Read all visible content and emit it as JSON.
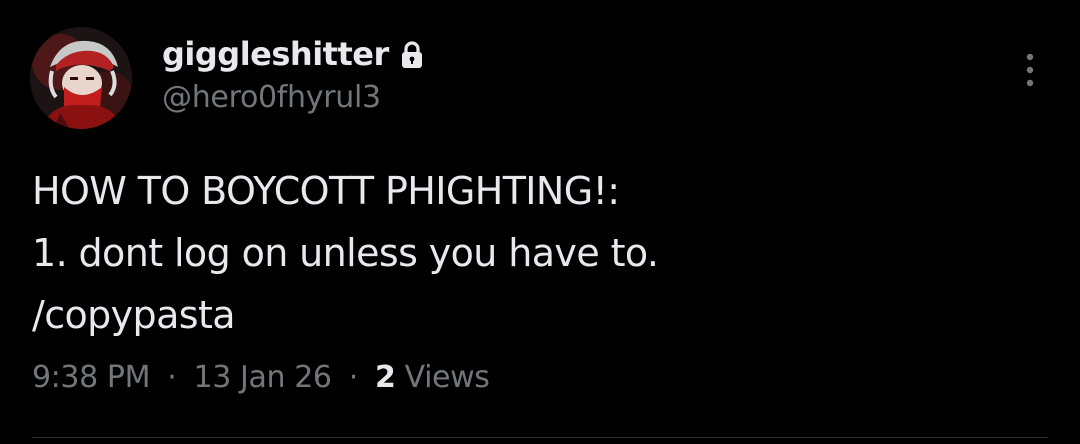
{
  "author": {
    "display_name": "giggleshitter",
    "handle": "@hero0fhyrul3",
    "protected_icon": "lock-icon",
    "avatar": "avatar-image"
  },
  "tweet": {
    "lines": [
      "HOW TO BOYCOTT PHIGHTING!:",
      "1. dont log on unless you have to.",
      "/copypasta"
    ]
  },
  "meta": {
    "time": "9:38 PM",
    "separator": "·",
    "date": "13 Jan 26",
    "views_count": "2",
    "views_label": "Views"
  },
  "menu": {
    "icon": "more-vertical-icon"
  },
  "colors": {
    "background": "#000000",
    "primary_text": "#e7e9ea",
    "secondary_text": "#71767b",
    "divider": "#2f3336"
  }
}
